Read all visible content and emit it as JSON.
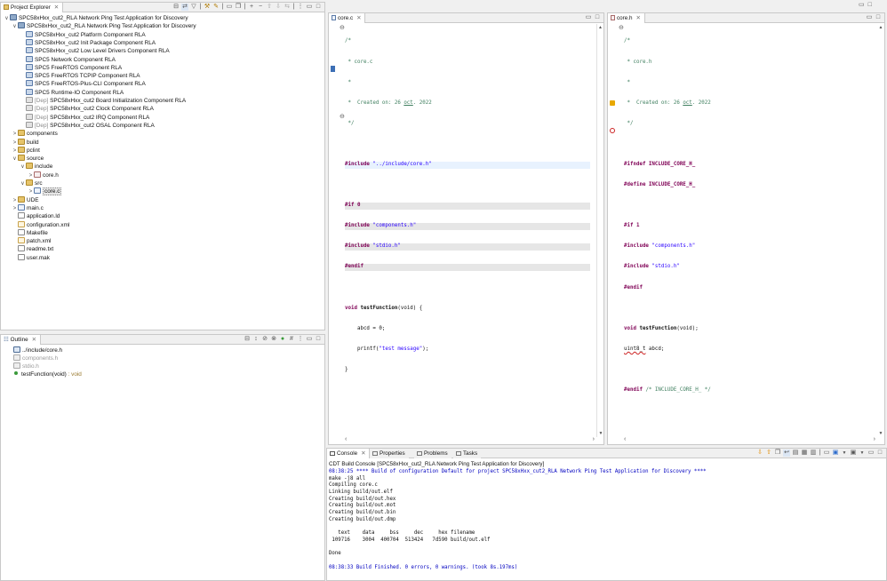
{
  "project_explorer": {
    "tab_label": "Project Explorer",
    "items": [
      {
        "label": "SPC58xHxx_cut2_RLA Network Ping Test Application for Discovery",
        "indent": 0,
        "tw": "∨",
        "icon": "proj"
      },
      {
        "label": "SPC58xHxx_cut2_RLA Network Ping Test Application for Discovery",
        "indent": 1,
        "tw": "∨",
        "icon": "proj"
      },
      {
        "label": "SPC58xHxx_cut2 Platform Component RLA",
        "indent": 2,
        "tw": "",
        "icon": "comp"
      },
      {
        "label": "SPC58xHxx_cut2 Init Package Component RLA",
        "indent": 2,
        "tw": "",
        "icon": "comp"
      },
      {
        "label": "SPC58xHxx_cut2 Low Level Drivers Component RLA",
        "indent": 2,
        "tw": "",
        "icon": "comp"
      },
      {
        "label": "SPC5 Network Component RLA",
        "indent": 2,
        "tw": "",
        "icon": "comp"
      },
      {
        "label": "SPC5 FreeRTOS Component RLA",
        "indent": 2,
        "tw": "",
        "icon": "comp"
      },
      {
        "label": "SPC5 FreeRTOS TCPIP Component RLA",
        "indent": 2,
        "tw": "",
        "icon": "comp"
      },
      {
        "label": "SPC5 FreeRTOS-Plus-CLI Component RLA",
        "indent": 2,
        "tw": "",
        "icon": "comp"
      },
      {
        "label": "SPC5 Runtime-IO Component RLA",
        "indent": 2,
        "tw": "",
        "icon": "comp"
      },
      {
        "dep": "[Dep]",
        "label": "SPC58xHxx_cut2 Board Initialization Component RLA",
        "indent": 2,
        "tw": "",
        "icon": "dep"
      },
      {
        "dep": "[Dep]",
        "label": "SPC58xHxx_cut2 Clock Component RLA",
        "indent": 2,
        "tw": "",
        "icon": "dep"
      },
      {
        "dep": "[Dep]",
        "label": "SPC58xHxx_cut2 IRQ Component RLA",
        "indent": 2,
        "tw": "",
        "icon": "dep"
      },
      {
        "dep": "[Dep]",
        "label": "SPC58xHxx_cut2 OSAL Component RLA",
        "indent": 2,
        "tw": "",
        "icon": "dep"
      },
      {
        "label": "components",
        "indent": 1,
        "tw": ">",
        "icon": "folder"
      },
      {
        "label": "build",
        "indent": 1,
        "tw": ">",
        "icon": "folder"
      },
      {
        "label": "pclint",
        "indent": 1,
        "tw": ">",
        "icon": "folder"
      },
      {
        "label": "source",
        "indent": 1,
        "tw": "∨",
        "icon": "sfolder"
      },
      {
        "label": "include",
        "indent": 2,
        "tw": "∨",
        "icon": "folder"
      },
      {
        "label": "core.h",
        "indent": 3,
        "tw": ">",
        "icon": "hfile"
      },
      {
        "label": "src",
        "indent": 2,
        "tw": "∨",
        "icon": "folder"
      },
      {
        "label": "core.c",
        "indent": 3,
        "tw": ">",
        "icon": "cfile",
        "selected": true
      },
      {
        "label": "UDE",
        "indent": 1,
        "tw": ">",
        "icon": "folder"
      },
      {
        "label": "main.c",
        "indent": 1,
        "tw": ">",
        "icon": "cfile"
      },
      {
        "label": "application.ld",
        "indent": 1,
        "tw": "",
        "icon": "file"
      },
      {
        "label": "configuration.xml",
        "indent": 1,
        "tw": "",
        "icon": "xml"
      },
      {
        "label": "Makefile",
        "indent": 1,
        "tw": "",
        "icon": "file"
      },
      {
        "label": "patch.xml",
        "indent": 1,
        "tw": "",
        "icon": "xml"
      },
      {
        "label": "readme.txt",
        "indent": 1,
        "tw": "",
        "icon": "file"
      },
      {
        "label": "user.mak",
        "indent": 1,
        "tw": "",
        "icon": "file"
      }
    ]
  },
  "outline": {
    "tab_label": "Outline",
    "items": [
      {
        "label": "../include/core.h",
        "grey": false
      },
      {
        "label": "components.h",
        "grey": true
      },
      {
        "label": "stdio.h",
        "grey": true
      },
      {
        "label": "testFunction(void)",
        "suffix": " : void",
        "grey": false
      }
    ]
  },
  "editor_left": {
    "tab_label": "core.c",
    "lines": {
      "l1": "/*",
      "l2": " * core.c",
      "l3": " *",
      "l4a": " *  Created on: 26 ",
      "l4b": "oct",
      "l4c": ". 2022",
      "l5": " */",
      "inc1a": "#include ",
      "inc1b": "\"../include/core.h\"",
      "if0": "#if 0",
      "inc2a": "#include ",
      "inc2b": "\"components.h\"",
      "inc3a": "#include ",
      "inc3b": "\"stdio.h\"",
      "endif": "#endif",
      "fn1a": "void ",
      "fn1b": "testFunction",
      "fn1c": "(void) {",
      "fn2": "    abcd = 0;",
      "fn3a": "    printf(",
      "fn3b": "\"test message\"",
      "fn3c": ");",
      "fn4": "}"
    }
  },
  "editor_right": {
    "tab_label": "core.h",
    "lines": {
      "l1": "/*",
      "l2": " * core.h",
      "l3": " *",
      "l4a": " *  Created on: 26 ",
      "l4b": "oct",
      "l4c": ". 2022",
      "l5": " */",
      "ifndef": "#ifndef INCLUDE_CORE_H_",
      "define": "#define INCLUDE_CORE_H_",
      "if1": "#if 1",
      "inc1a": "#include ",
      "inc1b": "\"components.h\"",
      "inc2a": "#include ",
      "inc2b": "\"stdio.h\"",
      "endif": "#endif",
      "fn1a": "void ",
      "fn1b": "testFunction",
      "fn1c": "(void);",
      "fn2a": "uint8_t",
      "fn2b": " abcd;",
      "end1": "#endif ",
      "end2": "/* INCLUDE_CORE_H_ */"
    }
  },
  "bottom": {
    "tabs": [
      "Console",
      "Properties",
      "Problems",
      "Tasks"
    ],
    "console_title": "CDT Build Console [SPC58xHxx_cut2_RLA Network Ping Test Application for Discovery]",
    "lines": [
      {
        "text": "08:38:25 **** Build of configuration Default for project SPC58xHxx_cut2_RLA Network Ping Test Application for Discovery ****",
        "blue": true
      },
      {
        "text": "make -j8 all",
        "blue": false
      },
      {
        "text": "Compiling core.c",
        "blue": false
      },
      {
        "text": "Linking build/out.elf",
        "blue": false
      },
      {
        "text": "Creating build/out.hex",
        "blue": false
      },
      {
        "text": "Creating build/out.mot",
        "blue": false
      },
      {
        "text": "Creating build/out.bin",
        "blue": false
      },
      {
        "text": "Creating build/out.dmp",
        "blue": false
      },
      {
        "text": "",
        "blue": false
      },
      {
        "text": "   text    data     bss     dec     hex filename",
        "blue": false
      },
      {
        "text": " 109716    3004  400704  513424   7d590 build/out.elf",
        "blue": false
      },
      {
        "text": "",
        "blue": false
      },
      {
        "text": "Done",
        "blue": false
      },
      {
        "text": "",
        "blue": false
      },
      {
        "text": "08:38:33 Build Finished. 0 errors, 0 warnings. (took 8s.197ms)",
        "blue": true
      }
    ]
  },
  "colors": {
    "accent": "#4a6a94",
    "comment": "#3f7f5f",
    "keyword": "#7f0055",
    "string": "#2a00ff",
    "console_info": "#0000c0"
  }
}
